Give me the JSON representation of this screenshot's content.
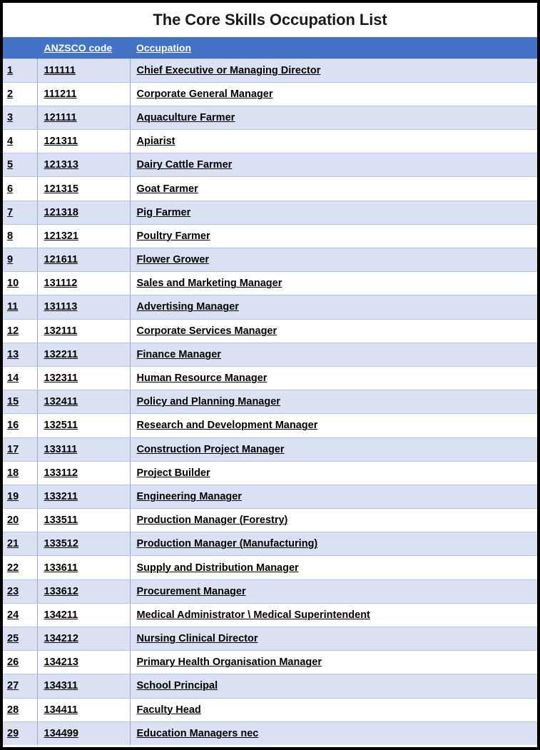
{
  "document": {
    "title": "The Core Skills Occupation List"
  },
  "colors": {
    "header_blue": "#4472C4",
    "row_shaded": "#D9E1F2",
    "row_plain": "#FFFFFF",
    "grid_line": "#B4C6E7",
    "column_divider": "#8EAADB",
    "outer_border": "#000000",
    "text": "#000000",
    "header_text": "#FFFFFF"
  },
  "table": {
    "columns": [
      {
        "key": "index",
        "label": ""
      },
      {
        "key": "code",
        "label": "ANZSCO code"
      },
      {
        "key": "occupation",
        "label": "Occupation"
      }
    ],
    "rows": [
      {
        "index": "1",
        "code": "111111",
        "occupation": "Chief Executive or Managing Director"
      },
      {
        "index": "2",
        "code": "111211",
        "occupation": "Corporate General Manager"
      },
      {
        "index": "3",
        "code": "121111",
        "occupation": "Aquaculture Farmer"
      },
      {
        "index": "4",
        "code": "121311",
        "occupation": "Apiarist"
      },
      {
        "index": "5",
        "code": "121313",
        "occupation": "Dairy Cattle Farmer"
      },
      {
        "index": "6",
        "code": "121315",
        "occupation": "Goat Farmer"
      },
      {
        "index": "7",
        "code": "121318",
        "occupation": "Pig Farmer"
      },
      {
        "index": "8",
        "code": "121321",
        "occupation": "Poultry Farmer"
      },
      {
        "index": "9",
        "code": "121611",
        "occupation": "Flower Grower"
      },
      {
        "index": "10",
        "code": "131112",
        "occupation": "Sales and Marketing Manager"
      },
      {
        "index": "11",
        "code": "131113",
        "occupation": "Advertising Manager"
      },
      {
        "index": "12",
        "code": "132111",
        "occupation": "Corporate Services Manager"
      },
      {
        "index": "13",
        "code": "132211",
        "occupation": "Finance Manager"
      },
      {
        "index": "14",
        "code": "132311",
        "occupation": "Human Resource Manager"
      },
      {
        "index": "15",
        "code": "132411",
        "occupation": "Policy and Planning Manager"
      },
      {
        "index": "16",
        "code": "132511",
        "occupation": "Research and Development Manager"
      },
      {
        "index": "17",
        "code": "133111",
        "occupation": "Construction Project Manager"
      },
      {
        "index": "18",
        "code": "133112",
        "occupation": "Project Builder"
      },
      {
        "index": "19",
        "code": "133211",
        "occupation": "Engineering Manager"
      },
      {
        "index": "20",
        "code": "133511",
        "occupation": "Production Manager (Forestry)"
      },
      {
        "index": "21",
        "code": "133512",
        "occupation": "Production Manager (Manufacturing)"
      },
      {
        "index": "22",
        "code": "133611",
        "occupation": "Supply and Distribution Manager"
      },
      {
        "index": "23",
        "code": "133612",
        "occupation": "Procurement Manager"
      },
      {
        "index": "24",
        "code": "134211",
        "occupation": "Medical Administrator \\ Medical Superintendent"
      },
      {
        "index": "25",
        "code": "134212",
        "occupation": "Nursing Clinical Director"
      },
      {
        "index": "26",
        "code": "134213",
        "occupation": "Primary Health Organisation Manager"
      },
      {
        "index": "27",
        "code": "134311",
        "occupation": "School Principal"
      },
      {
        "index": "28",
        "code": "134411",
        "occupation": "Faculty Head"
      },
      {
        "index": "29",
        "code": "134499",
        "occupation": "Education Managers nec"
      }
    ]
  }
}
